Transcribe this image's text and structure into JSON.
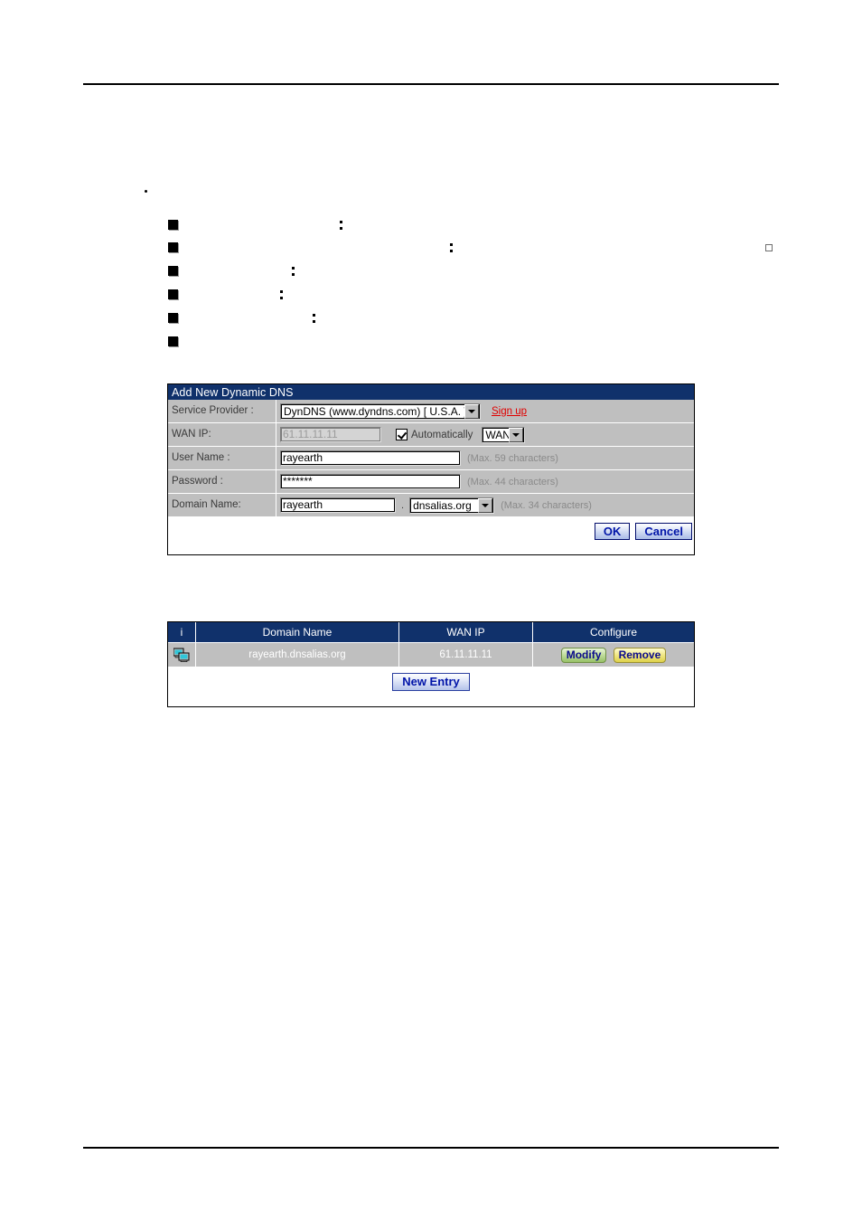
{
  "page": {
    "rules": {
      "top_label": "header-rule",
      "bottom_label": "footer-rule"
    }
  },
  "outline": {
    "lead_bullet": "",
    "items": [
      {
        "marker": "square",
        "text": "",
        "colon": ":"
      },
      {
        "marker": "square",
        "text": "",
        "colon": ":"
      },
      {
        "marker": "square",
        "text": "",
        "colon": ":"
      },
      {
        "marker": "square",
        "text": "",
        "colon": ":"
      },
      {
        "marker": "square",
        "text": "",
        "colon": ":"
      },
      {
        "marker": "square",
        "text": "",
        "colon": ""
      }
    ]
  },
  "dialog": {
    "title": "Add New Dynamic DNS",
    "rows": {
      "service_provider": {
        "label": "Service Provider :",
        "value": "DynDNS (www.dyndns.com) [ U.S.A. ]",
        "signup_label": "Sign up"
      },
      "wan_ip": {
        "label": "WAN IP:",
        "value": "61.11.11.11",
        "auto_label": "Automatically",
        "auto_checked": true,
        "interface": "WAN"
      },
      "user_name": {
        "label": "User Name :",
        "value": "rayearth",
        "hint": "(Max. 59 characters)"
      },
      "password": {
        "label": "Password :",
        "value": "*******",
        "hint": "(Max. 44 characters)"
      },
      "domain_name": {
        "label": "Domain Name:",
        "value": "rayearth",
        "separator": ".",
        "suffix": "dnsalias.org",
        "hint": "(Max. 34 characters)"
      }
    },
    "buttons": {
      "ok": "OK",
      "cancel": "Cancel"
    }
  },
  "list": {
    "headers": {
      "info": "i",
      "domain_name": "Domain Name",
      "wan_ip": "WAN IP",
      "configure": "Configure"
    },
    "rows": [
      {
        "icon": "network-computer-icon",
        "domain_name": "rayearth.dnsalias.org",
        "wan_ip": "61.11.11.11",
        "modify": "Modify",
        "remove": "Remove"
      }
    ],
    "new_entry": "New Entry"
  },
  "colors": {
    "title_bar": "#10316b",
    "row_bg": "#bfbfbf",
    "link_red": "#e00000",
    "button_blue_text": "#0014a8"
  }
}
